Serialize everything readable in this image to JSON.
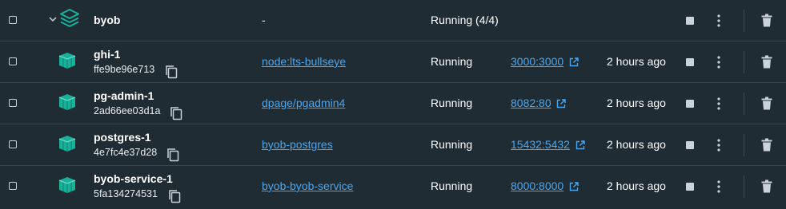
{
  "group": {
    "name": "byob",
    "image": "-",
    "status": "Running (4/4)"
  },
  "containers": [
    {
      "name": "ghi-1",
      "id": "ffe9be96e713",
      "image": "node:lts-bullseye",
      "status": "Running",
      "port": "3000:3000",
      "started": "2 hours ago"
    },
    {
      "name": "pg-admin-1",
      "id": "2ad66ee03d1a",
      "image": "dpage/pgadmin4",
      "status": "Running",
      "port": "8082:80",
      "started": "2 hours ago"
    },
    {
      "name": "postgres-1",
      "id": "4e7fc4e37d28",
      "image": "byob-postgres",
      "status": "Running",
      "port": "15432:5432",
      "started": "2 hours ago"
    },
    {
      "name": "byob-service-1",
      "id": "5fa134274531",
      "image": "byob-byob-service",
      "status": "Running",
      "port": "8000:8000",
      "started": "2 hours ago"
    }
  ],
  "icons": {
    "expand": "chevron-down-icon",
    "stack": "compose-stack-icon",
    "container": "container-icon",
    "copy": "copy-icon",
    "external": "external-link-icon",
    "stop": "stop-icon",
    "more": "more-vertical-icon",
    "delete": "trash-icon"
  },
  "colors": {
    "background": "#202c33",
    "accent_teal": "#18b29a",
    "link": "#4aa6f0",
    "text": "#ffffff"
  }
}
